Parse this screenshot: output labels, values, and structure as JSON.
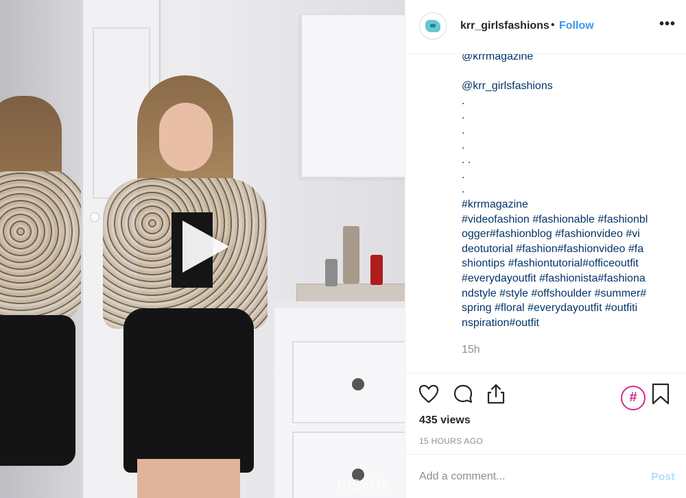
{
  "media": {
    "watermark": "InShOt",
    "play_icon": "play-icon"
  },
  "header": {
    "username": "krr_girlsfashions",
    "separator": "•",
    "follow_label": "Follow",
    "more_icon": "more-options-icon",
    "more_label": "•••"
  },
  "caption": {
    "lines": [
      "@krrmagazine",
      "",
      "@krr_girlsfashions",
      ".",
      ".",
      ".",
      ".",
      ". .",
      ".",
      ".",
      "#krrmagazine",
      "#videofashion #fashionable #fashionbl",
      "ogger#fashionblog #fashionvideo #vi",
      "deotutorial #fashion#fashionvideo #fa",
      "shiontips #fashiontutorial#officeoutfit",
      "#everydayoutfit #fashionista#fashiona",
      "ndstyle #style #offshoulder #summer#",
      "spring #floral #everydayoutfit #outfiti",
      "nspiration#outfit"
    ]
  },
  "post": {
    "time": "15h",
    "views": "435 views",
    "posted_ago": "15 HOURS AGO"
  },
  "actions": {
    "icons": [
      "heart-icon",
      "comment-icon",
      "share-icon",
      "hashtag-icon",
      "bookmark-icon"
    ],
    "hashtag_label": "#"
  },
  "comment": {
    "placeholder": "Add a comment...",
    "post_label": "Post"
  },
  "colors": {
    "link": "#003569",
    "follow": "#3897f0",
    "post_disabled": "#b2dffc",
    "hashtag": "#d22a8a"
  }
}
